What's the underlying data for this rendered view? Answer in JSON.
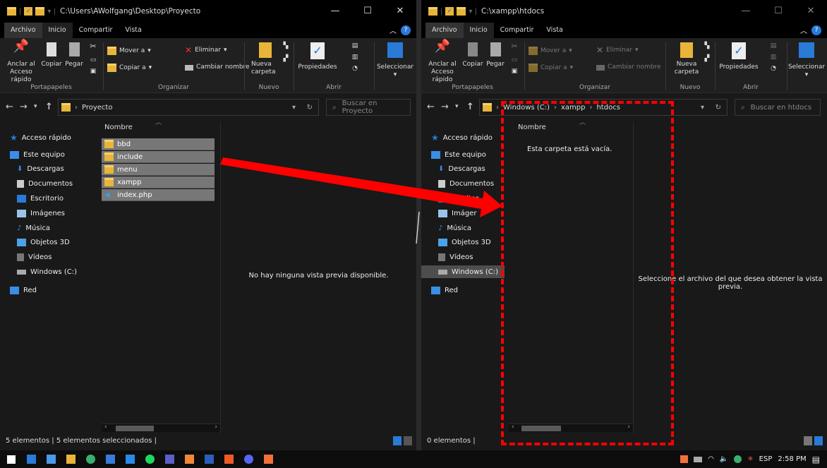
{
  "left": {
    "title": "C:\\Users\\AWolfgang\\Desktop\\Proyecto",
    "tabs": [
      "Archivo",
      "Inicio",
      "Compartir",
      "Vista"
    ],
    "ribbon": {
      "pin": "Anclar al Acceso rápido",
      "copy": "Copiar",
      "paste": "Pegar",
      "move_to": "Mover a",
      "copy_to": "Copiar a",
      "delete": "Eliminar",
      "rename": "Cambiar nombre",
      "new_folder": "Nueva carpeta",
      "properties": "Propiedades",
      "select": "Seleccionar",
      "groups": [
        "Portapapeles",
        "Organizar",
        "Nuevo",
        "Abrir"
      ]
    },
    "address": [
      "Proyecto"
    ],
    "search_placeholder": "Buscar en Proyecto",
    "column": "Nombre",
    "files": [
      {
        "name": "bbd",
        "type": "folder"
      },
      {
        "name": "include",
        "type": "folder"
      },
      {
        "name": "menu",
        "type": "folder"
      },
      {
        "name": "xampp",
        "type": "folder"
      },
      {
        "name": "index.php",
        "type": "file"
      }
    ],
    "preview": "No hay ninguna vista previa disponible.",
    "status": "5 elementos  |  5 elementos seleccionados  |"
  },
  "right": {
    "title": "C:\\xampp\\htdocs",
    "tabs": [
      "Archivo",
      "Inicio",
      "Compartir",
      "Vista"
    ],
    "address": [
      "Windows (C:)",
      "xampp",
      "htdocs"
    ],
    "search_placeholder": "Buscar en htdocs",
    "column": "Nombre",
    "empty": "Esta carpeta está vacía.",
    "preview": "Seleccione el archivo del que desea obtener la vista previa.",
    "status": "0 elementos  |"
  },
  "sidebar": {
    "quick": "Acceso rápido",
    "this_pc": "Este equipo",
    "items": [
      "Descargas",
      "Documentos",
      "Escritorio",
      "Imágenes",
      "Música",
      "Objetos 3D",
      "Vídeos",
      "Windows (C:)"
    ],
    "network": "Red"
  },
  "right_sidebar_items": [
    "Descargas",
    "Documentos",
    "Escritor",
    "Imáger",
    "Música",
    "Objetos 3D",
    "Vídeos",
    "Windows (C:)"
  ],
  "taskbar": {
    "lang": "ESP",
    "time": "2:58 PM",
    "icons": [
      "start-icon",
      "folder-icon",
      "store-icon",
      "files-icon",
      "app-icon",
      "remote-icon",
      "vscode-icon",
      "spotify-icon",
      "teams-icon",
      "sublime-icon",
      "word-icon",
      "brave-icon",
      "discord-icon",
      "xampp-icon"
    ]
  },
  "colors": {
    "annotation": "#ff0000",
    "accent": "#2a7ad8",
    "folder": "#e8b53a"
  }
}
